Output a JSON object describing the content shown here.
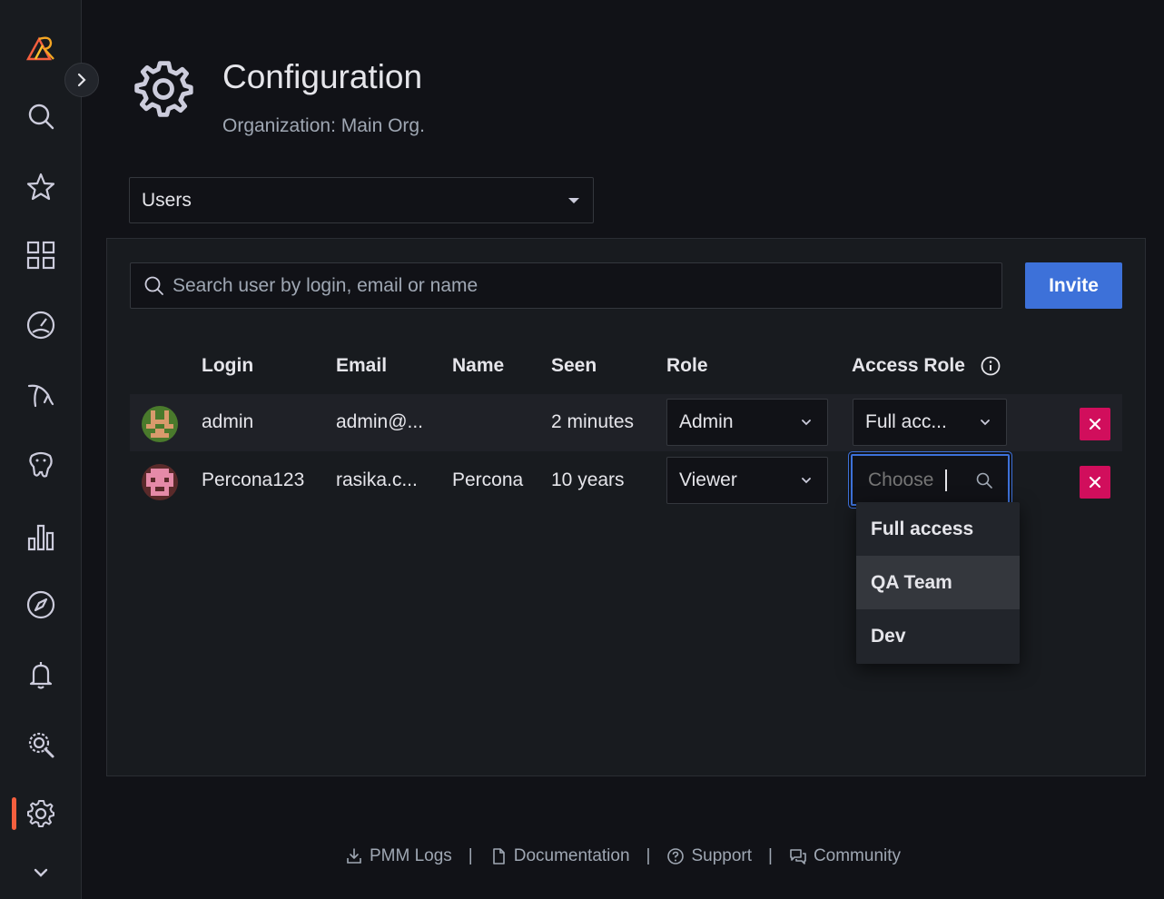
{
  "sidebar": {
    "items": [
      "logo-icon",
      "search-icon",
      "star-icon",
      "dashboards-icon",
      "gauge-icon",
      "mysql-icon",
      "postgresql-icon",
      "bar-chart-icon",
      "explore-icon",
      "bell-icon",
      "qan-icon",
      "gear-icon",
      "chevron-down-icon"
    ],
    "active": "gear-icon",
    "accent": "#f55f3e"
  },
  "header": {
    "title": "Configuration",
    "subtitle": "Organization: Main Org."
  },
  "nav_select": {
    "value": "Users"
  },
  "search": {
    "placeholder": "Search user by login, email or name"
  },
  "invite_label": "Invite",
  "table": {
    "columns": [
      "Login",
      "Email",
      "Name",
      "Seen",
      "Role",
      "Access Role"
    ],
    "rows": [
      {
        "login": "admin",
        "email": "admin@...",
        "name": "",
        "seen": "2 minutes",
        "role": "Admin",
        "access_role": "Full acc..."
      },
      {
        "login": "Percona123",
        "email": "rasika.c...",
        "name": "Percona",
        "seen": "10 years",
        "role": "Viewer",
        "access_role_placeholder": "Choose"
      }
    ]
  },
  "dropdown": {
    "options": [
      "Full access",
      "QA Team",
      "Dev"
    ],
    "highlighted": "QA Team"
  },
  "footer": {
    "links": [
      "PMM Logs",
      "Documentation",
      "Support",
      "Community"
    ],
    "separator": "|"
  },
  "colors": {
    "primary": "#3d71d9",
    "danger": "#d10e5c",
    "background": "#111217",
    "panel": "#181b1f"
  }
}
